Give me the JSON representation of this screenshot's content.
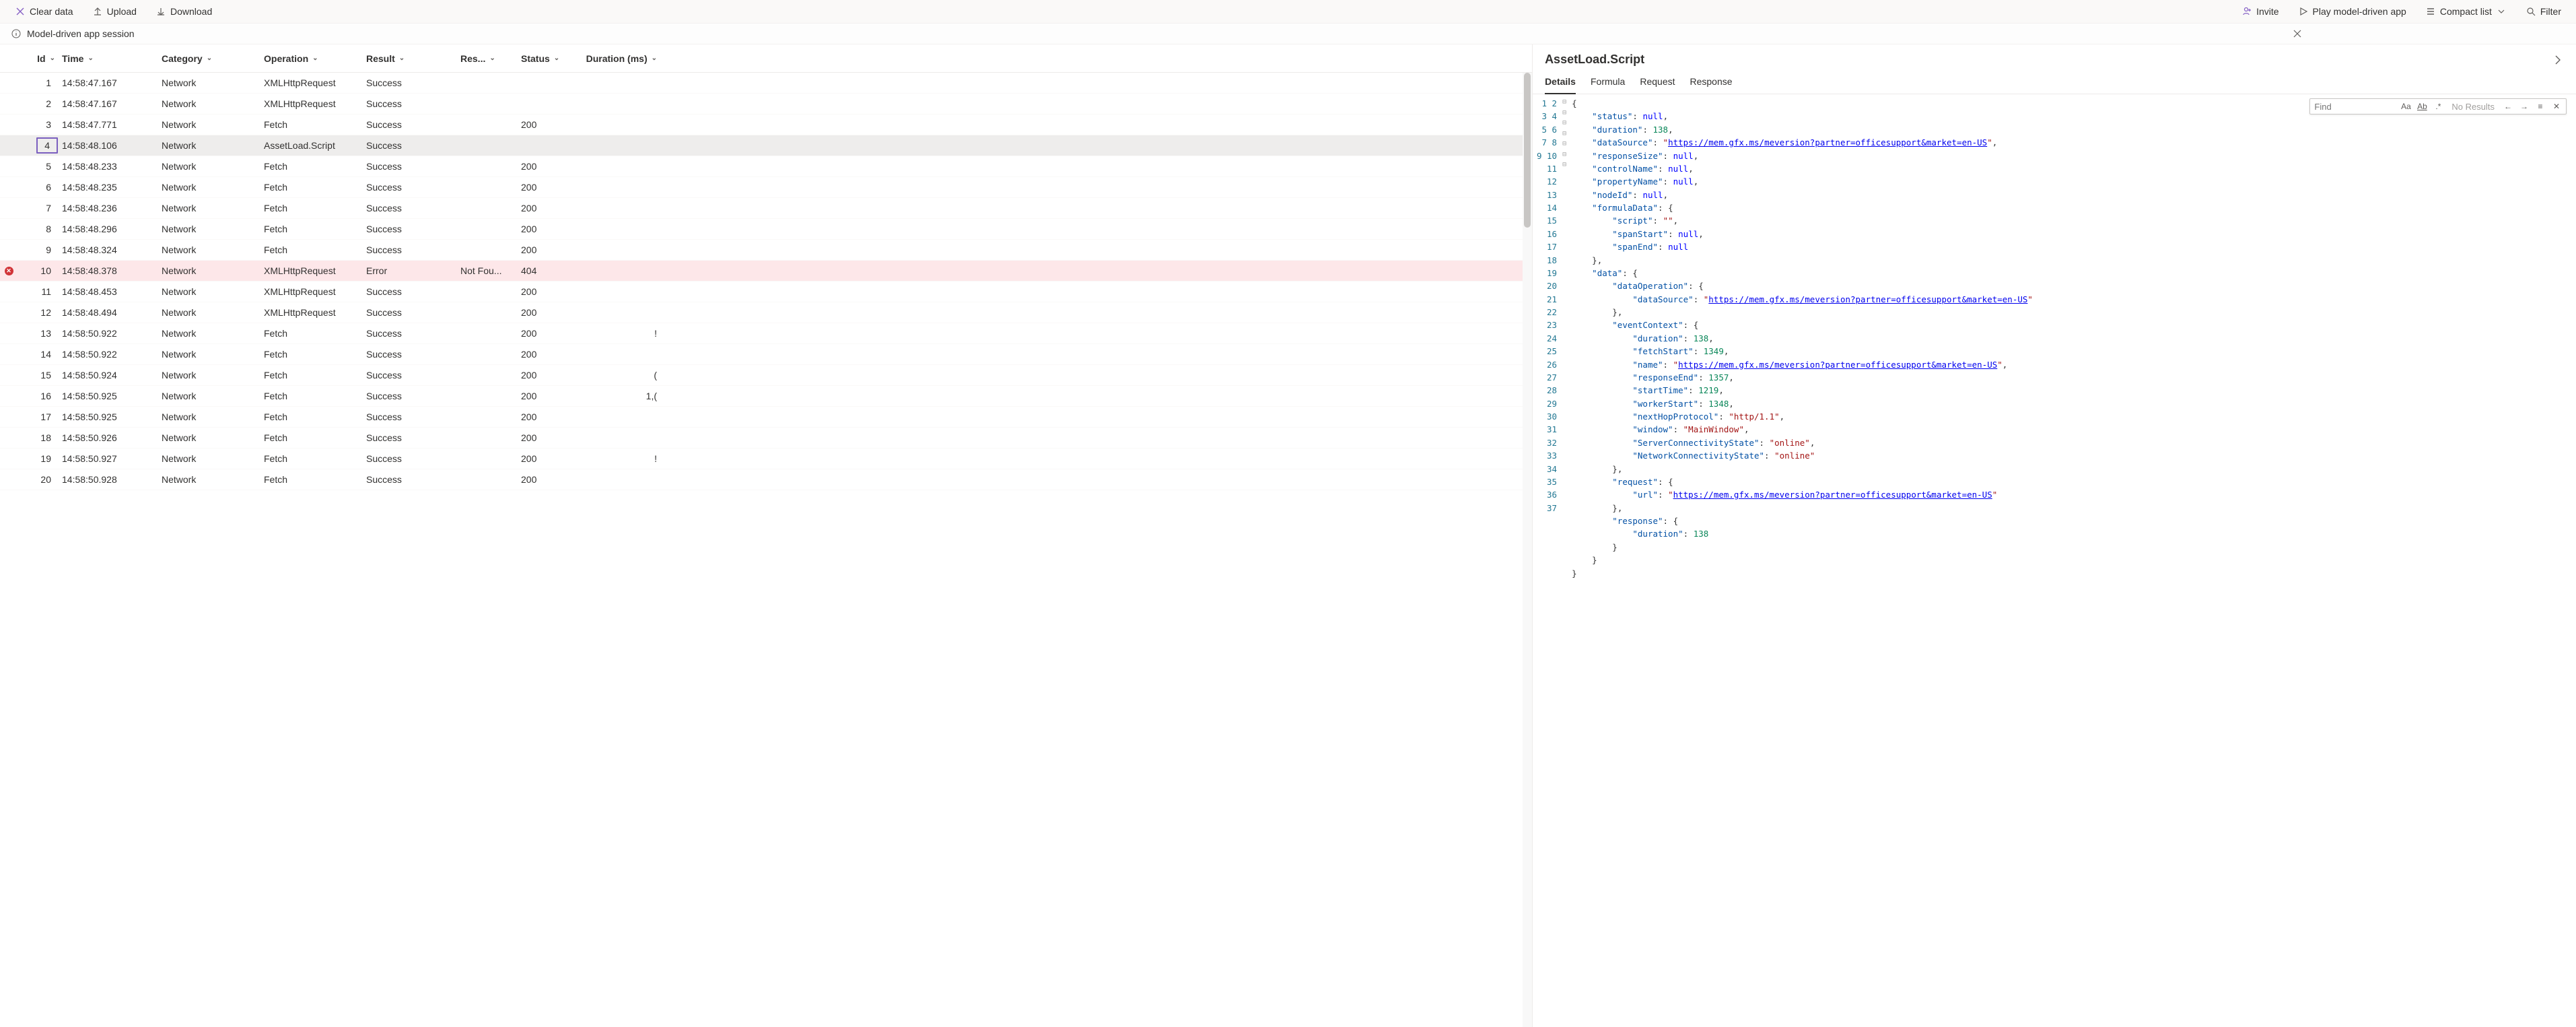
{
  "toolbar": {
    "clear": "Clear data",
    "upload": "Upload",
    "download": "Download",
    "invite": "Invite",
    "play": "Play model-driven app",
    "compact": "Compact list",
    "filter": "Filter"
  },
  "session": {
    "label": "Model-driven app session"
  },
  "table": {
    "headers": {
      "id": "Id",
      "time": "Time",
      "category": "Category",
      "operation": "Operation",
      "result": "Result",
      "res2": "Res...",
      "status": "Status",
      "duration": "Duration (ms)"
    },
    "rows": [
      {
        "id": "1",
        "time": "14:58:47.167",
        "category": "Network",
        "operation": "XMLHttpRequest",
        "result": "Success",
        "res2": "",
        "status": "",
        "dur": ""
      },
      {
        "id": "2",
        "time": "14:58:47.167",
        "category": "Network",
        "operation": "XMLHttpRequest",
        "result": "Success",
        "res2": "",
        "status": "",
        "dur": ""
      },
      {
        "id": "3",
        "time": "14:58:47.771",
        "category": "Network",
        "operation": "Fetch",
        "result": "Success",
        "res2": "",
        "status": "200",
        "dur": ""
      },
      {
        "id": "4",
        "time": "14:58:48.106",
        "category": "Network",
        "operation": "AssetLoad.Script",
        "result": "Success",
        "res2": "",
        "status": "",
        "dur": "",
        "selected": true
      },
      {
        "id": "5",
        "time": "14:58:48.233",
        "category": "Network",
        "operation": "Fetch",
        "result": "Success",
        "res2": "",
        "status": "200",
        "dur": ""
      },
      {
        "id": "6",
        "time": "14:58:48.235",
        "category": "Network",
        "operation": "Fetch",
        "result": "Success",
        "res2": "",
        "status": "200",
        "dur": ""
      },
      {
        "id": "7",
        "time": "14:58:48.236",
        "category": "Network",
        "operation": "Fetch",
        "result": "Success",
        "res2": "",
        "status": "200",
        "dur": ""
      },
      {
        "id": "8",
        "time": "14:58:48.296",
        "category": "Network",
        "operation": "Fetch",
        "result": "Success",
        "res2": "",
        "status": "200",
        "dur": ""
      },
      {
        "id": "9",
        "time": "14:58:48.324",
        "category": "Network",
        "operation": "Fetch",
        "result": "Success",
        "res2": "",
        "status": "200",
        "dur": ""
      },
      {
        "id": "10",
        "time": "14:58:48.378",
        "category": "Network",
        "operation": "XMLHttpRequest",
        "result": "Error",
        "res2": "Not Fou...",
        "status": "404",
        "dur": "",
        "error": true
      },
      {
        "id": "11",
        "time": "14:58:48.453",
        "category": "Network",
        "operation": "XMLHttpRequest",
        "result": "Success",
        "res2": "",
        "status": "200",
        "dur": ""
      },
      {
        "id": "12",
        "time": "14:58:48.494",
        "category": "Network",
        "operation": "XMLHttpRequest",
        "result": "Success",
        "res2": "",
        "status": "200",
        "dur": ""
      },
      {
        "id": "13",
        "time": "14:58:50.922",
        "category": "Network",
        "operation": "Fetch",
        "result": "Success",
        "res2": "",
        "status": "200",
        "dur": "!"
      },
      {
        "id": "14",
        "time": "14:58:50.922",
        "category": "Network",
        "operation": "Fetch",
        "result": "Success",
        "res2": "",
        "status": "200",
        "dur": ""
      },
      {
        "id": "15",
        "time": "14:58:50.924",
        "category": "Network",
        "operation": "Fetch",
        "result": "Success",
        "res2": "",
        "status": "200",
        "dur": "("
      },
      {
        "id": "16",
        "time": "14:58:50.925",
        "category": "Network",
        "operation": "Fetch",
        "result": "Success",
        "res2": "",
        "status": "200",
        "dur": "1,("
      },
      {
        "id": "17",
        "time": "14:58:50.925",
        "category": "Network",
        "operation": "Fetch",
        "result": "Success",
        "res2": "",
        "status": "200",
        "dur": ""
      },
      {
        "id": "18",
        "time": "14:58:50.926",
        "category": "Network",
        "operation": "Fetch",
        "result": "Success",
        "res2": "",
        "status": "200",
        "dur": ""
      },
      {
        "id": "19",
        "time": "14:58:50.927",
        "category": "Network",
        "operation": "Fetch",
        "result": "Success",
        "res2": "",
        "status": "200",
        "dur": "!"
      },
      {
        "id": "20",
        "time": "14:58:50.928",
        "category": "Network",
        "operation": "Fetch",
        "result": "Success",
        "res2": "",
        "status": "200",
        "dur": ""
      }
    ]
  },
  "details": {
    "title": "AssetLoad.Script",
    "tabs": {
      "details": "Details",
      "formula": "Formula",
      "request": "Request",
      "response": "Response"
    },
    "find": {
      "placeholder": "Find",
      "noresults": "No Results"
    },
    "json": {
      "status": null,
      "duration": 138,
      "dataSource": "https://mem.gfx.ms/meversion?partner=officesupport&market=en-US",
      "responseSize": null,
      "controlName": null,
      "propertyName": null,
      "nodeId": null,
      "formulaData": {
        "script": "",
        "spanStart": null,
        "spanEnd": null
      },
      "data": {
        "dataOperation": {
          "dataSource": "https://mem.gfx.ms/meversion?partner=officesupport&market=en-US"
        },
        "eventContext": {
          "duration": 138,
          "fetchStart": 1349,
          "name": "https://mem.gfx.ms/meversion?partner=officesupport&market=en-US",
          "responseEnd": 1357,
          "startTime": 1219,
          "workerStart": 1348,
          "nextHopProtocol": "http/1.1",
          "window": "MainWindow",
          "ServerConnectivityState": "online",
          "NetworkConnectivityState": "online"
        },
        "request": {
          "url": "https://mem.gfx.ms/meversion?partner=officesupport&market=en-US"
        },
        "response": {
          "duration": 138
        }
      }
    }
  }
}
